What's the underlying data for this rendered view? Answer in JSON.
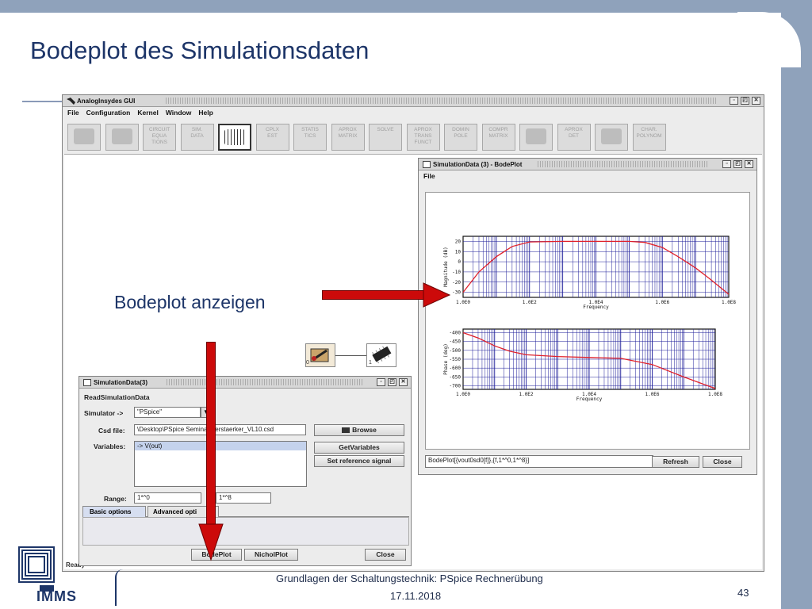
{
  "slide": {
    "title": "Bodeplot des Simulationsdaten",
    "annotation": "Bodeplot anzeigen",
    "footer": "Grundlagen der Schaltungstechnik: PSpice Rechnerübung",
    "date": "17.11.2018",
    "page": "43",
    "logo_text": "IMMS"
  },
  "main_window": {
    "title": "AnalogInsydes GUI",
    "menu": [
      "File",
      "Configuration",
      "Kernel",
      "Window",
      "Help"
    ],
    "toolbar": [
      "",
      "",
      "CIRCUIT\nEQUA\nTIONS",
      "SIM.\nDATA",
      "",
      "CPLX\nEST",
      "STATIS\nTICS",
      "APROX\nMATRIX",
      "SOLVE",
      "APROX\nTRANS\nFUNCT",
      "DOMIN\nPOLE",
      "COMPR\nMATRIX",
      "",
      "APROX\nDET",
      "",
      "CHAR.\nPOLYNOM"
    ],
    "status": "Ready",
    "node_labels": [
      "0",
      "1"
    ]
  },
  "bode_window": {
    "title": "SimulationData (3) - BodePlot",
    "menu": [
      "File"
    ],
    "command": "BodePlot[{vout0sd0[f]},{f,1*^0,1*^8}]",
    "refresh_label": "Refresh",
    "close_label": "Close",
    "magnitude_ylabel": "Magnitude (dB)",
    "phase_ylabel": "Phase (deg)",
    "xlabel": "Frequency"
  },
  "sim_window": {
    "title": "SimulationData(3)",
    "section": "ReadSimulationData",
    "simulator_label": "Simulator ->",
    "simulator_value": "\"PSpice\"",
    "csd_label": "Csd file:",
    "csd_value": "\\Desktop\\PSpice Seminar\\Verstaerker_VL10.csd",
    "browse_label": "Browse",
    "variables_label": "Variables:",
    "variables_items": [
      "-> V(out)"
    ],
    "getvars_label": "GetVariables",
    "setref_label": "Set reference signal",
    "range_label": "Range:",
    "range_from": "1*^0",
    "range_to": "1*^8",
    "tabs": [
      "Basic options",
      "Advanced opti"
    ],
    "bodeplot_label": "BodePlot",
    "nicholplot_label": "NicholPlot",
    "close_label": "Close"
  },
  "chart_data": [
    {
      "type": "line",
      "title": "",
      "xlabel": "Frequency",
      "ylabel": "Magnitude (dB)",
      "x_scale": "log",
      "xlim": [
        1,
        100000000
      ],
      "ylim": [
        -35,
        25
      ],
      "x_ticks": [
        "1.0E0",
        "1.0E2",
        "1.0E4",
        "1.0E6",
        "1.0E8"
      ],
      "y_ticks": [
        20,
        10,
        0,
        -10,
        -20,
        -30
      ],
      "grid": true,
      "series": [
        {
          "color": "#e0202a",
          "x": [
            1,
            3,
            10,
            30,
            100,
            1000,
            10000,
            100000,
            300000,
            1000000,
            3000000,
            10000000,
            30000000,
            100000000
          ],
          "y": [
            -30,
            -10,
            5,
            15,
            19.5,
            20,
            20,
            20,
            19,
            14,
            5,
            -6,
            -18,
            -32
          ]
        }
      ]
    },
    {
      "type": "line",
      "title": "",
      "xlabel": "Frequency",
      "ylabel": "Phase (deg)",
      "x_scale": "log",
      "xlim": [
        1,
        100000000
      ],
      "ylim": [
        -720,
        -380
      ],
      "x_ticks": [
        "1.0E0",
        "1.0E2",
        "1.0E4",
        "1.0E6",
        "1.0E8"
      ],
      "y_ticks": [
        -400,
        -450,
        -500,
        -550,
        -600,
        -650,
        -700
      ],
      "grid": true,
      "series": [
        {
          "color": "#e0202a",
          "x": [
            1,
            3,
            10,
            30,
            100,
            1000,
            10000,
            100000,
            1000000,
            10000000,
            100000000
          ],
          "y": [
            -400,
            -430,
            -475,
            -505,
            -525,
            -535,
            -540,
            -545,
            -580,
            -650,
            -715
          ]
        }
      ]
    }
  ],
  "colors": {
    "slide_title": "#1d3568",
    "arrow": "#cc0a0a",
    "plot_line": "#e0202a",
    "grid": "#1e1e9a"
  }
}
